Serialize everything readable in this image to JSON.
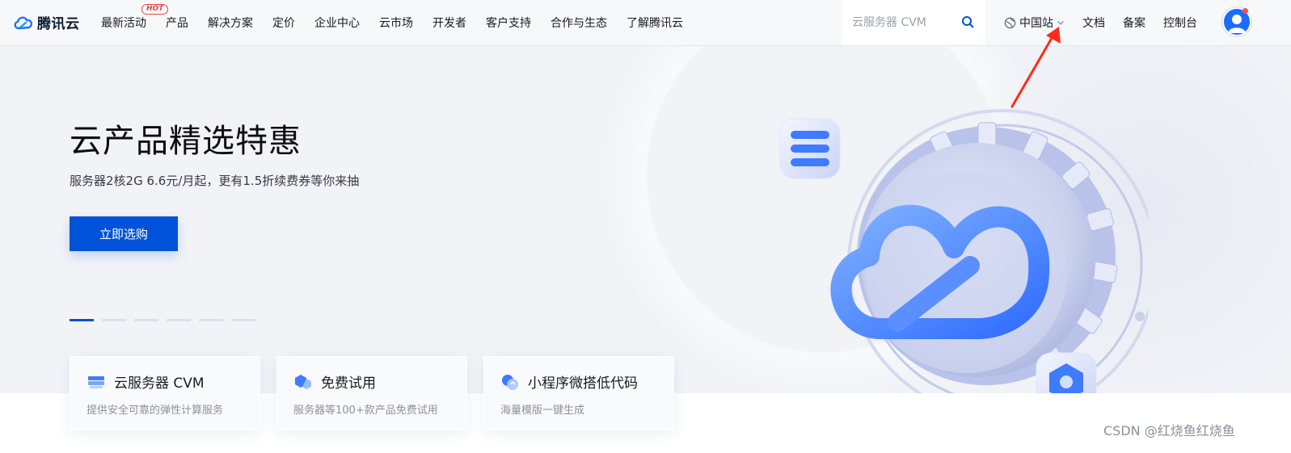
{
  "header": {
    "logo_text": "腾讯云",
    "nav": [
      {
        "label": "最新活动",
        "badge": "HOT"
      },
      {
        "label": "产品"
      },
      {
        "label": "解决方案"
      },
      {
        "label": "定价"
      },
      {
        "label": "企业中心"
      },
      {
        "label": "云市场"
      },
      {
        "label": "开发者"
      },
      {
        "label": "客户支持"
      },
      {
        "label": "合作与生态"
      },
      {
        "label": "了解腾讯云"
      }
    ],
    "search": {
      "placeholder": "云服务器 CVM"
    },
    "site_switch": "中国站",
    "links": [
      "文档",
      "备案",
      "控制台"
    ]
  },
  "hero": {
    "title": "云产品精选特惠",
    "subtitle": "服务器2核2G 6.6元/月起，更有1.5折续费券等你来抽",
    "cta": "立即选购",
    "slides_total": 6,
    "slide_active": 1
  },
  "cards": [
    {
      "title": "云服务器 CVM",
      "desc": "提供安全可靠的弹性计算服务",
      "icon": "server-icon"
    },
    {
      "title": "免费试用",
      "desc": "服务器等100+款产品免费试用",
      "icon": "cube-icon"
    },
    {
      "title": "小程序微搭低代码",
      "desc": "海量模版一键生成",
      "icon": "code-icon"
    }
  ],
  "watermark": "CSDN @红烧鱼红烧鱼",
  "colors": {
    "brand": "#0052d9",
    "hot": "#e54545",
    "annotation_arrow": "#ff2a1a"
  }
}
